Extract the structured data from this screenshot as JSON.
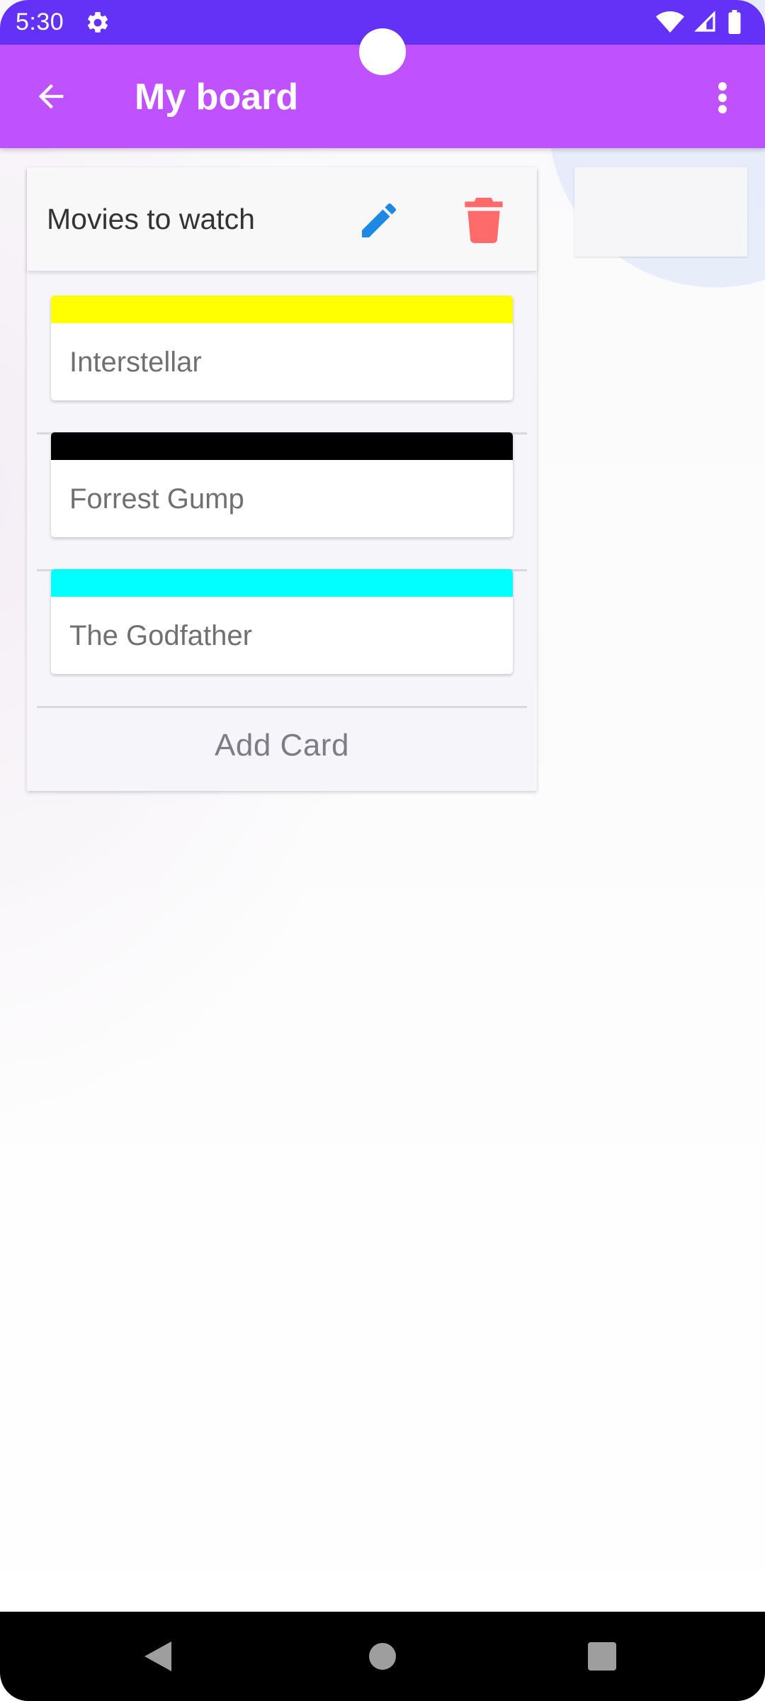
{
  "status_bar": {
    "time": "5:30",
    "icons": [
      "gear-icon",
      "wifi-icon",
      "signal-icon",
      "battery-icon"
    ],
    "color": "#6332f6"
  },
  "app_bar": {
    "title": "My board",
    "color": "#c051ff",
    "icons": [
      "arrow-back-icon",
      "more-vert-icon"
    ]
  },
  "list": {
    "title": "Movies to watch",
    "edit_icon_color": "#1e88e5",
    "delete_icon_color": "#ff6b6b",
    "cards": [
      {
        "label": "Interstellar",
        "color": "#ffff00"
      },
      {
        "label": "Forrest Gump",
        "color": "#000000"
      },
      {
        "label": "The Godfather",
        "color": "#00ffff"
      }
    ],
    "add_card_label": "Add Card"
  },
  "nav_bar": {
    "icons": [
      "nav-back-icon",
      "nav-home-icon",
      "nav-recents-icon"
    ]
  }
}
